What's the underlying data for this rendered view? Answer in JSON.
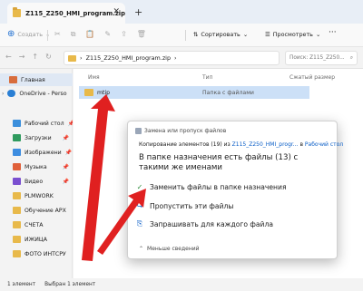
{
  "tab": {
    "title": "Z115_Z250_HMI_program.zip"
  },
  "toolbar": {
    "create": "Создать",
    "sort": "Сортировать",
    "view": "Просмотреть",
    "more": "···"
  },
  "address": {
    "path": "Z115_Z250_HMI_program.zip"
  },
  "search": {
    "placeholder": "Поиск: Z115_Z250..."
  },
  "sidebar": {
    "items": [
      {
        "label": "Главная"
      },
      {
        "label": "OneDrive - Perso"
      },
      {
        "label": "Рабочий стол"
      },
      {
        "label": "Загрузки"
      },
      {
        "label": "Изображени"
      },
      {
        "label": "Музыка"
      },
      {
        "label": "Видео"
      },
      {
        "label": "PLMWORK"
      },
      {
        "label": "Обучение АРХ"
      },
      {
        "label": "СЧЕТА"
      },
      {
        "label": "ИЖИЦА"
      },
      {
        "label": "ФОТО ИНТСРУ"
      }
    ]
  },
  "columns": {
    "name": "Имя",
    "type": "Тип",
    "compressed": "Сжатый размер"
  },
  "files": [
    {
      "name": "mtip",
      "type": "Папка с файлами"
    }
  ],
  "status": {
    "count": "1 элемент",
    "selected": "Выбран 1 элемент"
  },
  "dialog": {
    "title": "Замена или пропуск файлов",
    "copy_prefix": "Копирование элементов (19) из",
    "copy_source": "Z115_Z250_HMI_progr...",
    "copy_mid": "в",
    "copy_dest": "Рабочий стол",
    "heading": "В папке назначения есть файлы (13) с такими же именами",
    "options": [
      {
        "label": "Заменить файлы в папке назначения"
      },
      {
        "label": "Пропустить эти файлы"
      },
      {
        "label": "Запрашивать для каждого файла"
      }
    ],
    "less": "Меньше сведений"
  },
  "colors": {
    "accent": "#0a5ec7",
    "arrow": "#e02020",
    "selection": "#cce0f7"
  }
}
